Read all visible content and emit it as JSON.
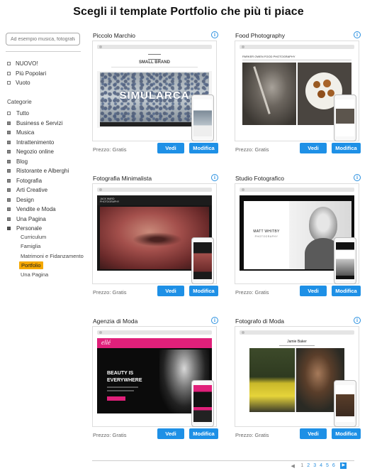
{
  "page": {
    "title": "Scegli il template Portfolio che più ti piace"
  },
  "sidebar": {
    "search_placeholder": "Ad esempio musica, fotografia",
    "quick": [
      "NUOVO!",
      "Più Popolari",
      "Vuoto"
    ],
    "categories_heading": "Categorie",
    "categories": [
      {
        "label": "Tutto",
        "kind": "none"
      },
      {
        "label": "Business e Servizi",
        "kind": "plus"
      },
      {
        "label": "Musica",
        "kind": "plus"
      },
      {
        "label": "Intrattenimento",
        "kind": "plus"
      },
      {
        "label": "Negozio online",
        "kind": "plus"
      },
      {
        "label": "Blog",
        "kind": "plus"
      },
      {
        "label": "Ristorante e Alberghi",
        "kind": "plus"
      },
      {
        "label": "Fotografia",
        "kind": "plus"
      },
      {
        "label": "Arti Creative",
        "kind": "plus"
      },
      {
        "label": "Design",
        "kind": "plus"
      },
      {
        "label": "Vendite e Moda",
        "kind": "plus"
      },
      {
        "label": "Una Pagina",
        "kind": "plus"
      },
      {
        "label": "Personale",
        "kind": "minus"
      }
    ],
    "subcategories": [
      "Curriculum",
      "Famiglia",
      "Matrimoni e Fidanzamento",
      "Portfolio",
      "Una Pagina"
    ],
    "active_subcategory": "Portfolio"
  },
  "cards": [
    {
      "title": "Piccolo Marchio",
      "price": "Prezzo: Gratis",
      "vedi": "Vedi",
      "modifica": "Modifica",
      "preview": {
        "brand": "SMALL BRAND",
        "headline": "SIMULARCA"
      }
    },
    {
      "title": "Food Photography",
      "price": "Prezzo: Gratis",
      "vedi": "Vedi",
      "modifica": "Modifica",
      "preview": {
        "brand": "PARKER OWEN FOOD PHOTOGRAPHY"
      }
    },
    {
      "title": "Fotografia Minimalista",
      "price": "Prezzo: Gratis",
      "vedi": "Vedi",
      "modifica": "Modifica",
      "preview": {
        "brand": "JACK WARD PHOTOGRAPHY"
      }
    },
    {
      "title": "Studio Fotografico",
      "price": "Prezzo: Gratis",
      "vedi": "Vedi",
      "modifica": "Modifica",
      "preview": {
        "brand": "MATT WHITBY",
        "sub": "PHOTOGRAPHY"
      }
    },
    {
      "title": "Agenzia di Moda",
      "price": "Prezzo: Gratis",
      "vedi": "Vedi",
      "modifica": "Modifica",
      "preview": {
        "brand": "ellé",
        "headline1": "BEAUTY IS",
        "headline2": "EVERYWHERE"
      }
    },
    {
      "title": "Fotografo di Moda",
      "price": "Prezzo: Gratis",
      "vedi": "Vedi",
      "modifica": "Modifica",
      "preview": {
        "brand": "Jamie Baker"
      }
    }
  ],
  "pagination": {
    "pages": [
      "1",
      "2",
      "3",
      "4",
      "5",
      "6"
    ],
    "current": "1"
  },
  "colors": {
    "accent": "#1e90e6",
    "active_highlight": "#f5a800",
    "fashion_pink": "#e0207a"
  },
  "icons": {
    "info": "info-icon",
    "prev": "arrow-left-icon",
    "next": "arrow-right-icon"
  }
}
